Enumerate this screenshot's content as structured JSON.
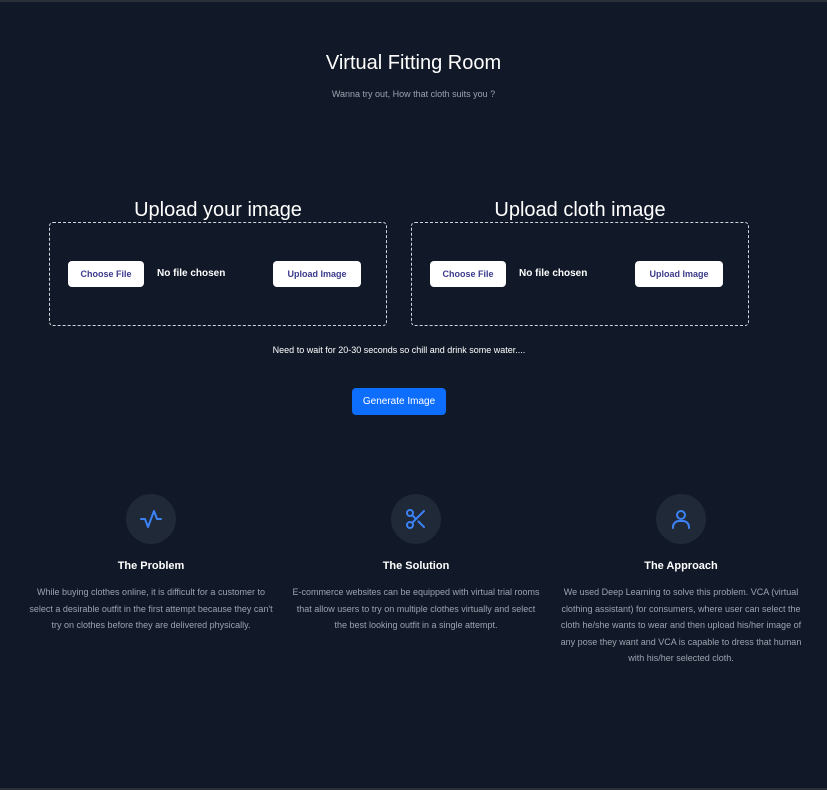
{
  "header": {
    "title": "Virtual Fitting Room",
    "subtitle": "Wanna try out, How that cloth suits you ?"
  },
  "uploads": [
    {
      "heading": "Upload your image",
      "choose_label": "Choose File",
      "file_status": "No file chosen",
      "upload_label": "Upload Image"
    },
    {
      "heading": "Upload cloth image",
      "choose_label": "Choose File",
      "file_status": "No file chosen",
      "upload_label": "Upload Image"
    }
  ],
  "wait_note": "Need to wait for 20-30 seconds so chill and drink some water....",
  "generate_label": "Generate Image",
  "features": [
    {
      "icon": "activity-icon",
      "title": "The Problem",
      "text": "While buying clothes online, it is difficult for a customer to select a desirable outfit in the first attempt because they can't try on clothes before they are delivered physically."
    },
    {
      "icon": "scissors-icon",
      "title": "The Solution",
      "text": "E-commerce websites can be equipped with virtual trial rooms that allow users to try on multiple clothes virtually and select the best looking outfit in a single attempt."
    },
    {
      "icon": "person-icon",
      "title": "The Approach",
      "text": "We used Deep Learning to solve this problem. VCA (virtual clothing assistant) for consumers, where user can select the cloth he/she wants to wear and then upload his/her image of any pose they want and VCA is capable to dress that human with his/her selected cloth."
    }
  ],
  "colors": {
    "background": "#111827",
    "accent": "#0d6efd",
    "icon_stroke": "#3b82f6",
    "icon_circle": "#1f2937",
    "muted_text": "#9ca3af"
  }
}
